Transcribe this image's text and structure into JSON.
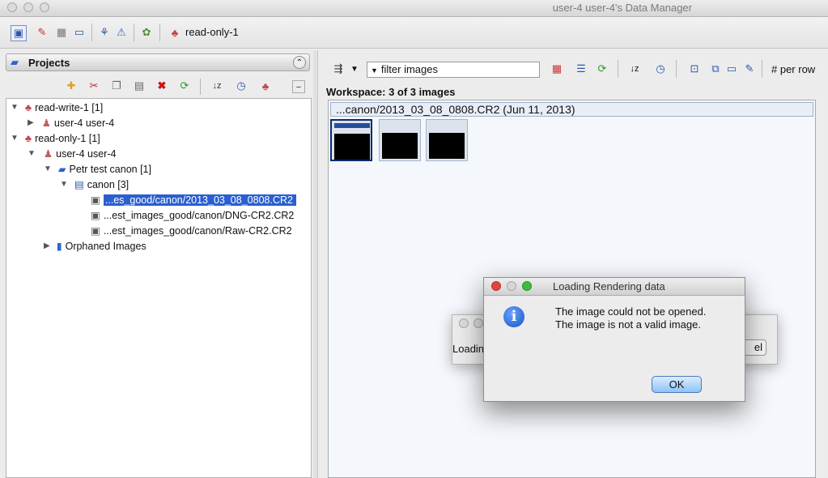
{
  "window": {
    "title": "user-4 user-4's Data Manager"
  },
  "toolbar": {
    "group_label": "read-only-1"
  },
  "left_panel": {
    "header": "Projects",
    "tree": [
      {
        "label": "read-write-1 [1]"
      },
      {
        "label": "user-4 user-4"
      },
      {
        "label": "read-only-1 [1]"
      },
      {
        "label": "user-4 user-4"
      },
      {
        "label": "Petr test canon [1]"
      },
      {
        "label": "canon [3]"
      },
      {
        "label": "...es_good/canon/2013_03_08_0808.CR2"
      },
      {
        "label": "...est_images_good/canon/DNG-CR2.CR2"
      },
      {
        "label": "...est_images_good/canon/Raw-CR2.CR2"
      },
      {
        "label": "Orphaned Images"
      }
    ]
  },
  "right_panel": {
    "filter_text": "filter  images",
    "per_row_label": "# per row",
    "workspace_label": "Workspace: 3 of 3 images",
    "gallery_header": "...canon/2013_03_08_0808.CR2 (Jun 11, 2013)"
  },
  "background_dialog": {
    "loading_text": "Loadin",
    "cancel_fragment": "el"
  },
  "dialog": {
    "title": "Loading Rendering data",
    "message_line1": "The image could not be opened.",
    "message_line2": "The image is not a valid image.",
    "ok_label": "OK"
  },
  "colors": {
    "selection": "#2a5fd1",
    "info_icon": "#1453c4"
  }
}
